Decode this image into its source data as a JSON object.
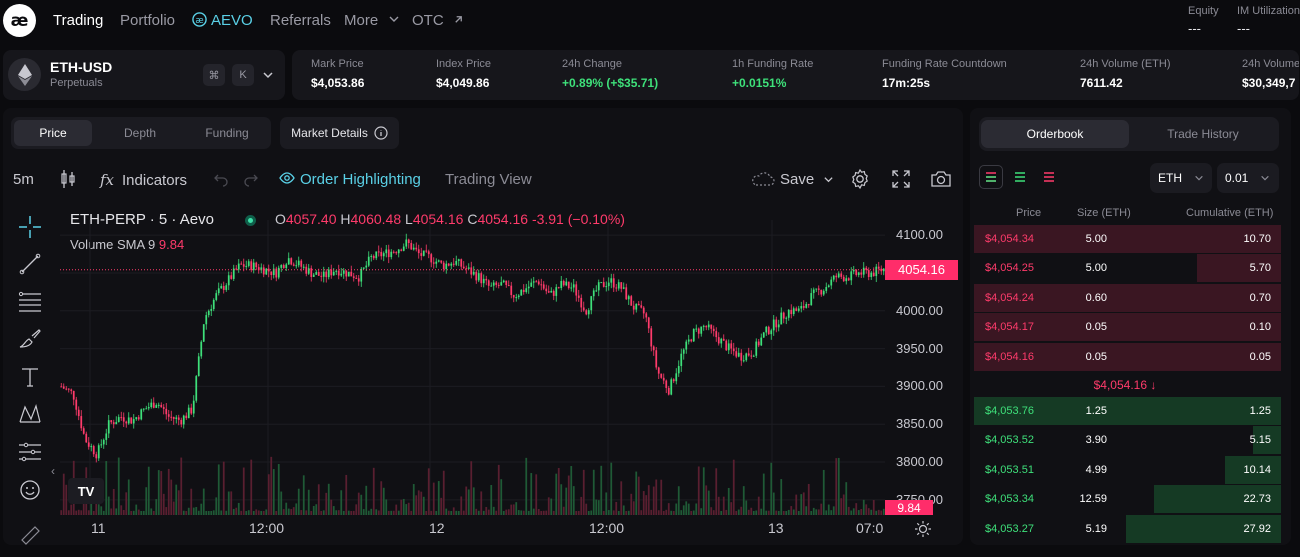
{
  "nav": {
    "logo": "æ",
    "items": [
      "Trading",
      "Portfolio",
      "AEVO",
      "Referrals",
      "More",
      "OTC"
    ],
    "account": [
      {
        "label": "Equity",
        "value": "---"
      },
      {
        "label": "IM Utilization",
        "value": "---"
      }
    ]
  },
  "instrument": {
    "name": "ETH-USD",
    "type": "Perpetuals",
    "kbd1": "⌘",
    "kbd2": "K"
  },
  "stats": [
    {
      "label": "Mark Price",
      "value": "$4,053.86",
      "tone": "neutral"
    },
    {
      "label": "Index Price",
      "value": "$4,049.86",
      "tone": "neutral"
    },
    {
      "label": "24h Change",
      "value": "+0.89% (+$35.71)",
      "tone": "positive"
    },
    {
      "label": "1h Funding Rate",
      "value": "+0.0151%",
      "tone": "positive"
    },
    {
      "label": "Funding Rate Countdown",
      "value": "17m:25s",
      "tone": "neutral"
    },
    {
      "label": "24h Volume (ETH)",
      "value": "7611.42",
      "tone": "neutral"
    },
    {
      "label": "24h Volume",
      "value": "$30,349,7",
      "tone": "neutral"
    }
  ],
  "chart_tabs": [
    "Price",
    "Depth",
    "Funding"
  ],
  "market_details": "Market Details",
  "chart_toolbar": {
    "interval": "5m",
    "indicators": "Indicators",
    "order_highlighting": "Order Highlighting",
    "trading_view": "Trading View",
    "save": "Save"
  },
  "chart_header": {
    "symbol": "ETH-PERP · 5 · Aevo",
    "o_label": "O",
    "o": "4057.40",
    "h_label": "H",
    "h": "4060.48",
    "l_label": "L",
    "l": "4054.16",
    "c_label": "C",
    "c": "4054.16",
    "change": "-3.91 (−0.10%)",
    "volume_label": "Volume SMA 9",
    "volume_value": "9.84"
  },
  "chart_data": {
    "type": "candlestick",
    "x_tick_labels": [
      "11",
      "12:00",
      "12",
      "12:00",
      "13",
      "07:0"
    ],
    "y_tick_labels": [
      "4100.00",
      "4050.00",
      "4000.00",
      "3950.00",
      "3900.00",
      "3850.00",
      "3800.00",
      "3750.00"
    ],
    "y_ticks": [
      4100,
      4050,
      4000,
      3950,
      3900,
      3850,
      3800,
      3750
    ],
    "ylim": [
      3730,
      4120
    ],
    "last_price": "4054.16",
    "last_price_value": 4054.16,
    "volume_sma_label": "9.84",
    "up_color": "#3ee07a",
    "down_color": "#ff3b6b",
    "close_path": [
      3900,
      3890,
      3830,
      3810,
      3850,
      3860,
      3855,
      3870,
      3880,
      3860,
      3855,
      3870,
      3990,
      4020,
      4040,
      4060,
      4060,
      4055,
      4050,
      4070,
      4060,
      4050,
      4045,
      4055,
      4050,
      4045,
      4070,
      4075,
      4080,
      4090,
      4075,
      4070,
      4060,
      4065,
      4055,
      4045,
      4030,
      4035,
      4020,
      4030,
      4040,
      4020,
      4035,
      4030,
      4000,
      4030,
      4040,
      4030,
      4005,
      3995,
      3920,
      3895,
      3940,
      3970,
      3980,
      3965,
      3950,
      3940,
      3945,
      3970,
      3985,
      4000,
      4000,
      4020,
      4030,
      4045,
      4045,
      4050,
      4050,
      4055
    ]
  },
  "orderbook": {
    "tabs": [
      "Orderbook",
      "Trade History"
    ],
    "asset": "ETH",
    "step": "0.01",
    "headers": [
      "Price",
      "Size (ETH)",
      "Cumulative (ETH)"
    ],
    "asks": [
      {
        "price": "$4,054.34",
        "size": "5.00",
        "cum": "10.70",
        "depth": 0.99
      },
      {
        "price": "$4,054.25",
        "size": "5.00",
        "cum": "5.70",
        "depth": 0.27
      },
      {
        "price": "$4,054.24",
        "size": "0.60",
        "cum": "0.70",
        "depth": 0.99
      },
      {
        "price": "$4,054.17",
        "size": "0.05",
        "cum": "0.10",
        "depth": 0.99
      },
      {
        "price": "$4,054.16",
        "size": "0.05",
        "cum": "0.05",
        "depth": 0.99
      }
    ],
    "mid_price": "$4,054.16",
    "bids": [
      {
        "price": "$4,053.76",
        "size": "1.25",
        "cum": "1.25",
        "depth": 0.99
      },
      {
        "price": "$4,053.52",
        "size": "3.90",
        "cum": "5.15",
        "depth": 0.09
      },
      {
        "price": "$4,053.51",
        "size": "4.99",
        "cum": "10.14",
        "depth": 0.18
      },
      {
        "price": "$4,053.34",
        "size": "12.59",
        "cum": "22.73",
        "depth": 0.41
      },
      {
        "price": "$4,053.27",
        "size": "5.19",
        "cum": "27.92",
        "depth": 0.5
      }
    ]
  }
}
